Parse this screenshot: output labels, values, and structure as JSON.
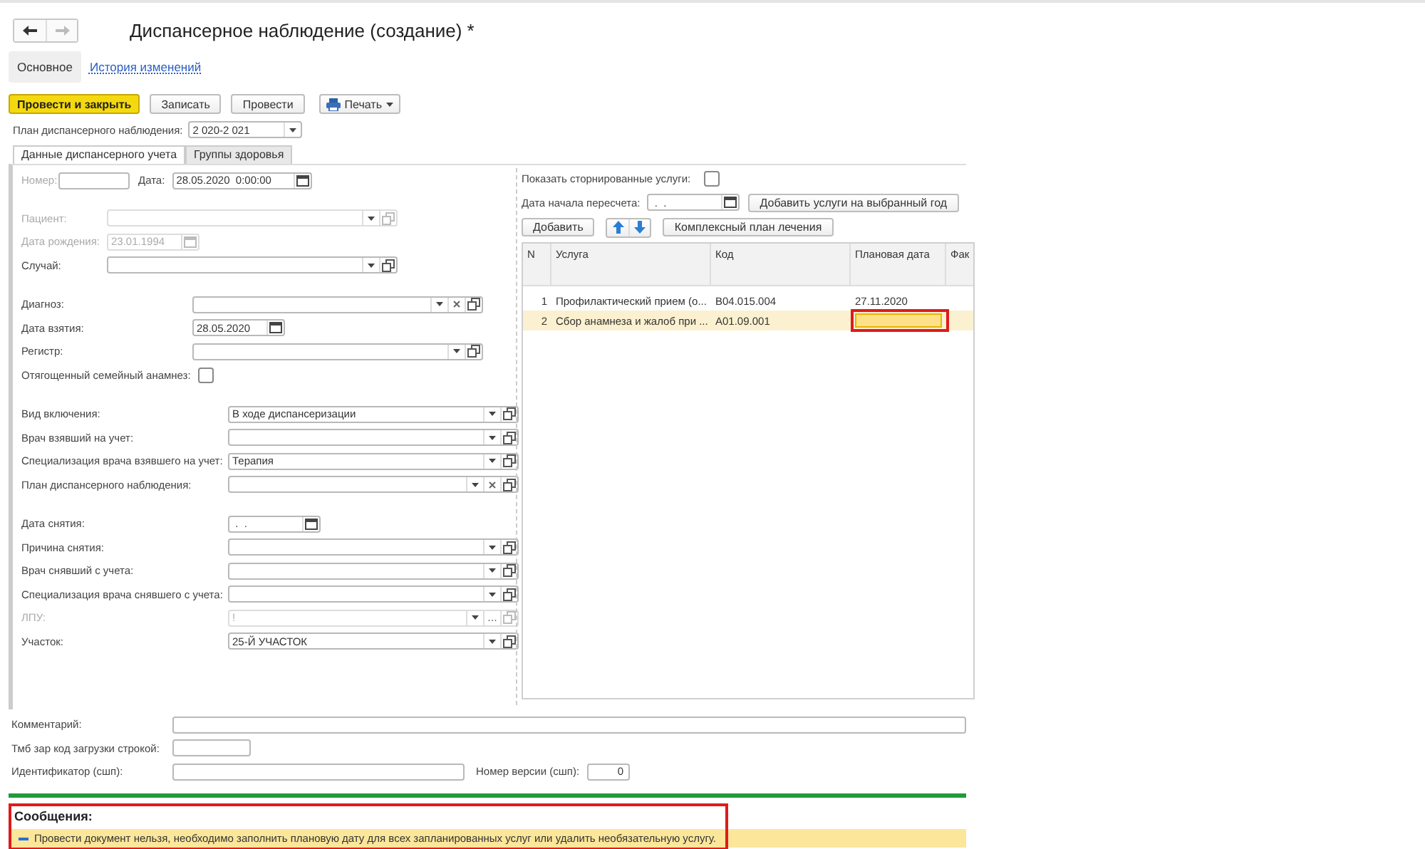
{
  "nav": {
    "back_enabled": true,
    "forward_enabled": false
  },
  "title": "Диспансерное наблюдение (создание) *",
  "sections": [
    {
      "label": "Основное",
      "selected": true
    },
    {
      "label": "История изменений",
      "selected": false
    }
  ],
  "command_bar": [
    {
      "label": "Провести и закрыть",
      "kind": "primary"
    },
    {
      "label": "Записать",
      "kind": "plain"
    },
    {
      "label": "Провести",
      "kind": "plain"
    },
    {
      "label": "Печать",
      "kind": "menu"
    }
  ],
  "plan": {
    "label": "План диспансерного наблюдения:",
    "value": "2 020-2 021"
  },
  "tabs": [
    {
      "label": "Данные диспансерного учета",
      "selected": true
    },
    {
      "label": "Группы здоровья",
      "selected": false
    }
  ],
  "header_row": {
    "number": {
      "label": "Номер:",
      "disabled": true
    },
    "date": {
      "label": "Дата:",
      "value": "28.05.2020  0:00:00",
      "disabled": false
    }
  },
  "groups": [
    [
      {
        "label": "Пациент:",
        "kind": "select",
        "disabled": true,
        "clearable": false
      },
      {
        "label": "Дата рождения:",
        "kind": "date",
        "value": "23.01.1994",
        "disabled": true
      },
      {
        "label": "Случай:",
        "kind": "select",
        "disabled": false,
        "clearable": false
      }
    ],
    [
      {
        "label": "Диагноз:",
        "kind": "select",
        "disabled": false,
        "clearable": true
      },
      {
        "label": "Дата взятия:",
        "kind": "date",
        "value": "28.05.2020",
        "disabled": false
      },
      {
        "label": "Регистр:",
        "kind": "select",
        "disabled": false,
        "clearable": false
      },
      {
        "label": "Отягощенный семейный анамнез:",
        "kind": "checkbox",
        "checked": false,
        "disabled": false
      }
    ],
    [
      {
        "label": "Вид включения:",
        "kind": "select",
        "value": "В ходе диспансеризации",
        "disabled": false,
        "clearable": false
      },
      {
        "label": "Врач взявший на учет:",
        "kind": "select",
        "disabled": false,
        "clearable": false
      },
      {
        "label": "Специализация врача взявшего на учет:",
        "kind": "select",
        "value": "Терапия",
        "disabled": false,
        "clearable": false
      },
      {
        "label": "План диспансерного наблюдения:",
        "kind": "select",
        "disabled": false,
        "clearable": true
      }
    ],
    [
      {
        "label": "Дата снятия:",
        "kind": "date",
        "value": " .  .",
        "disabled": false
      },
      {
        "label": "Причина снятия:",
        "kind": "select",
        "disabled": false,
        "clearable": false
      },
      {
        "label": "Врач снявший с учета:",
        "kind": "select",
        "disabled": false,
        "clearable": false
      },
      {
        "label": "Специализация врача снявшего с учета:",
        "kind": "select",
        "disabled": false,
        "clearable": false
      },
      {
        "label": "ЛПУ:",
        "kind": "select",
        "value": "!",
        "disabled": true,
        "clearable": false,
        "choose": "..."
      },
      {
        "label": "Участок:",
        "kind": "select",
        "value": "25-Й УЧАСТОК",
        "disabled": false,
        "clearable": false
      }
    ]
  ],
  "show_storno": {
    "label": "Показать сторнированные услуги:",
    "checked": false
  },
  "recalc_date": {
    "label": "Дата начала пересчета:",
    "value": " .  ."
  },
  "add_year_button": "Добавить услуги на выбранный год",
  "add_button": "Добавить",
  "plan_button": "Комплексный план лечения",
  "table": {
    "columns": [
      "N",
      "Услуга",
      "Код",
      "Плановая дата",
      "Фак"
    ],
    "rows": [
      {
        "n": "1",
        "service": "Профилактический прием (о...",
        "code": "B04.015.004",
        "plan_date": "27.11.2020",
        "selected": false,
        "editing": false,
        "outlined": false
      },
      {
        "n": "2",
        "service": "Сбор анамнеза и жалоб при ...",
        "code": "A01.09.001",
        "selected": true,
        "editing": true,
        "outlined": true
      }
    ]
  },
  "bottom": {
    "comment": {
      "label": "Комментарий:"
    },
    "tmb": {
      "label": "Тмб зар код загрузки строкой:"
    },
    "ident": {
      "label": "Идентификатор (сшп):"
    },
    "version": {
      "label": "Номер версии (сшп):",
      "value": "0"
    }
  },
  "messages": {
    "title": "Сообщения:",
    "outlined": true,
    "items": [
      {
        "text": "Провести документ нельзя, необходимо заполнить плановую дату для всех запланированных услуг или удалить необязательную услугу."
      }
    ]
  }
}
